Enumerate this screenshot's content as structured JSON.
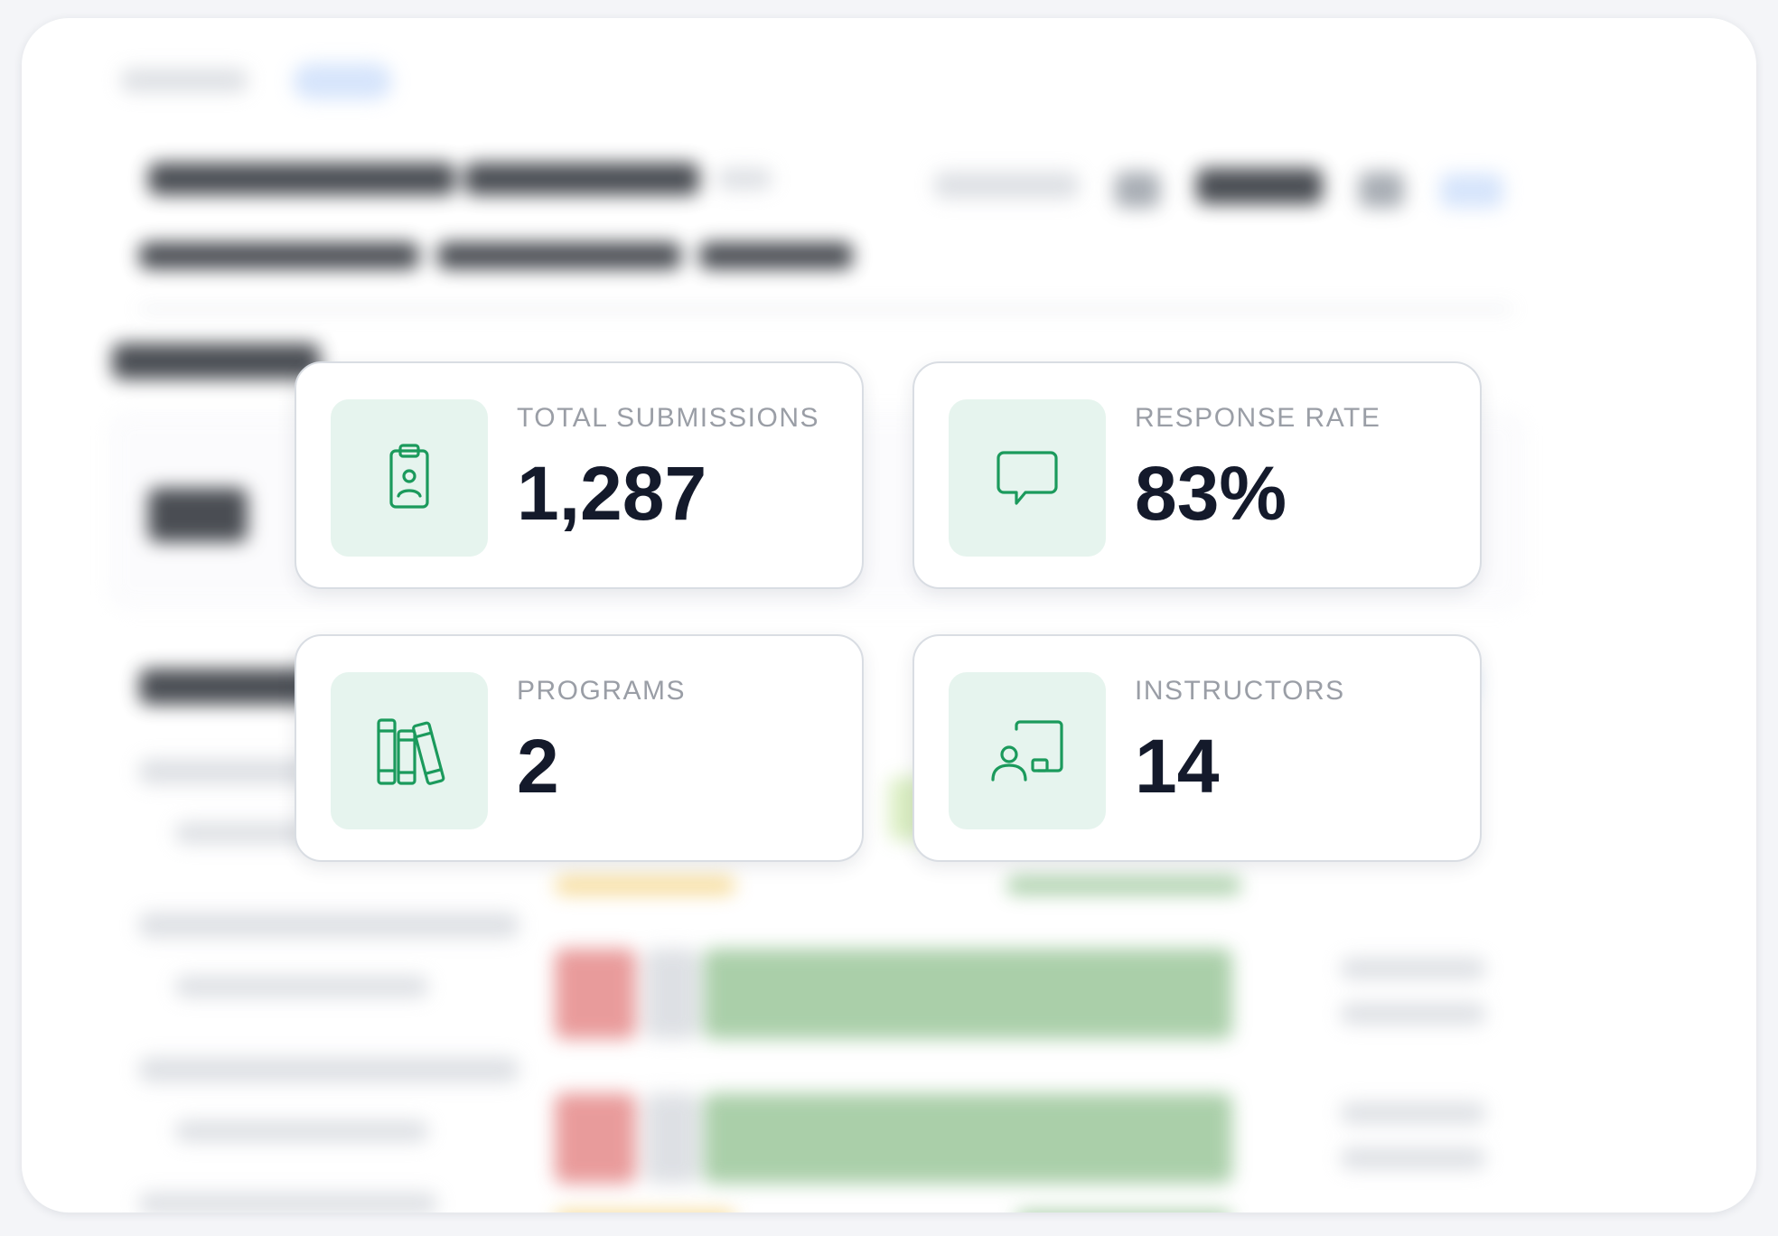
{
  "stats": [
    {
      "label": "TOTAL SUBMISSIONS",
      "value": "1,287",
      "icon": "clipboard-user-icon"
    },
    {
      "label": "RESPONSE RATE",
      "value": "83%",
      "icon": "chat-bubble-icon"
    },
    {
      "label": "PROGRAMS",
      "value": "2",
      "icon": "books-icon"
    },
    {
      "label": "INSTRUCTORS",
      "value": "14",
      "icon": "presenter-board-icon"
    }
  ],
  "colors": {
    "accent": "#1b9a5c",
    "icon_tile": "#e6f4ee",
    "value_text": "#141a2b",
    "label_text": "#9a9ea6"
  }
}
